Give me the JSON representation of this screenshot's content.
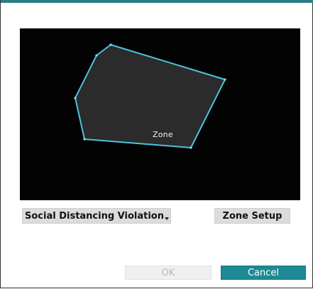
{
  "colors": {
    "accent": "#1e8a93",
    "zone_outline": "#4cc3dc",
    "zone_fill": "#2b2b2b",
    "preview_background": "#030303"
  },
  "preview": {
    "zone_label": "Zone"
  },
  "controls": {
    "event_type_value": "Social Distancing Violation",
    "zone_setup_label": "Zone Setup"
  },
  "footer": {
    "ok_label": "OK",
    "cancel_label": "Cancel"
  }
}
